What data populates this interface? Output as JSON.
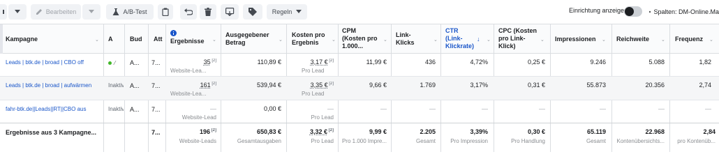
{
  "toolbar": {
    "edit_label": "Bearbeiten",
    "abtest_label": "A/B-Test",
    "rules_label": "Regeln",
    "device_label": "Einrichtung anzeigen",
    "columns_label": "Spalten: DM-Online.Ma"
  },
  "headers": {
    "kampagne": "Kampagne",
    "a": "A",
    "bud": "Bud",
    "att": "Att",
    "ergebnisse": "Ergebnisse",
    "ausgegeben": [
      "Ausgegebener",
      "Betrag"
    ],
    "kosten": [
      "Kosten pro",
      "Ergebnis"
    ],
    "cpm": [
      "CPM",
      "(Kosten pro",
      "1.000..."
    ],
    "linkklicks": [
      "Link-",
      "Klicks"
    ],
    "ctr": [
      "CTR",
      "(Link-",
      "Klickrate)"
    ],
    "cpc": [
      "CPC (Kosten",
      "pro Link-",
      "Klick)"
    ],
    "impressionen": "Impressionen",
    "reichweite": "Reichweite",
    "frequenz": "Frequenz"
  },
  "rows": [
    {
      "name": "Leads | btk.de | broad | CBO off",
      "status": "",
      "bud": "A...",
      "att": "7...",
      "ergebnisse": "35",
      "ergebnisse_sub": "Website-Lea...",
      "ausgegeben": "110,89 €",
      "kosten": "3,17 €",
      "kosten_sub": "Pro Lead",
      "cpm": "11,99 €",
      "linkklicks": "436",
      "ctr": "4,72%",
      "cpc": "0,25 €",
      "impressionen": "9.246",
      "reichweite": "5.088",
      "frequenz": "1,82"
    },
    {
      "name": "Leads | btk.de | broad | aufwärmen",
      "status": "Inaktiv",
      "bud": "A...",
      "att": "7...",
      "ergebnisse": "161",
      "ergebnisse_sub": "Website-Lea...",
      "ausgegeben": "539,94 €",
      "kosten": "3,35 €",
      "kosten_sub": "Pro Lead",
      "cpm": "9,66 €",
      "linkklicks": "1.769",
      "ctr": "3,17%",
      "cpc": "0,31 €",
      "impressionen": "55.873",
      "reichweite": "20.356",
      "frequenz": "2,74"
    },
    {
      "name": "fahr-btk.de||Leads||RT||CBO aus",
      "status": "Inaktiv",
      "bud": "A...",
      "att": "7...",
      "ergebnisse": "—",
      "ergebnisse_sub": "Website-Lead",
      "ausgegeben": "0,00 €",
      "kosten": "—",
      "kosten_sub": "Pro Lead",
      "cpm": "—",
      "linkklicks": "—",
      "ctr": "—",
      "cpc": "—",
      "impressionen": "—",
      "reichweite": "—",
      "frequenz": "—"
    }
  ],
  "total": {
    "name": "Ergebnisse aus 3 Kampagne...",
    "att": "7...",
    "ergebnisse": "196",
    "ergebnisse_sub": "Website-Leads",
    "ausgegeben": "650,83 €",
    "ausgegeben_sub": "Gesamtausgaben",
    "kosten": "3,32 €",
    "kosten_sub": "Pro Lead",
    "cpm": "9,99 €",
    "cpm_sub": "Pro 1.000 Impre...",
    "linkklicks": "2.205",
    "linkklicks_sub": "Gesamt",
    "ctr": "3,39%",
    "ctr_sub": "Pro Impression",
    "cpc": "0,30 €",
    "cpc_sub": "Pro Handlung",
    "impressionen": "65.119",
    "impressionen_sub": "Gesamt",
    "reichweite": "22.968",
    "reichweite_sub": "Kontenübersichts...",
    "frequenz": "2,84",
    "frequenz_sub": "pro Kontenüb..."
  },
  "colors": {
    "link": "#1a56c9",
    "active_dot": "#42b72a",
    "header_bg": "#fafbfc",
    "alt_row_bg": "#f5f6f7"
  }
}
